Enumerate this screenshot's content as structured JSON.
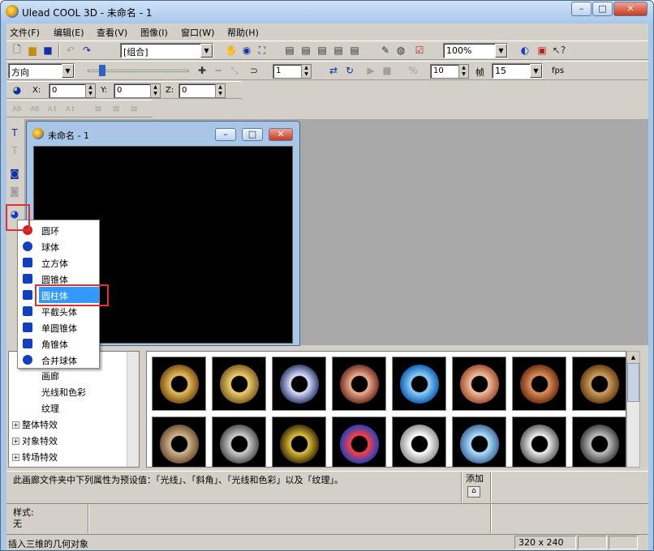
{
  "window": {
    "title": "Ulead COOL 3D - 未命名 - 1",
    "buttons": [
      "–",
      "□",
      "✕"
    ]
  },
  "menubar": [
    "文件(F)",
    "编辑(E)",
    "查看(V)",
    "图像(I)",
    "窗口(W)",
    "帮助(H)"
  ],
  "toolbar1": {
    "object_combo": "[组合]",
    "zoom_combo": "100%"
  },
  "toolbar2": {
    "mode_combo": "方向",
    "frame_value": "1",
    "fps_value": "10",
    "frames_label": "帧",
    "frames_value": "15",
    "fps_label": "fps"
  },
  "toolbar3": {
    "x_label": "X:",
    "x_value": "0",
    "y_label": "Y:",
    "y_value": "0",
    "z_label": "Z:",
    "z_value": "0"
  },
  "doc": {
    "title": "未命名 - 1",
    "buttons": [
      "–",
      "□",
      "✕"
    ]
  },
  "shape_menu": [
    {
      "label": "圆环",
      "icon": "torus-icon",
      "color": "#d02020"
    },
    {
      "label": "球体",
      "icon": "sphere-icon",
      "color": "#1040c0"
    },
    {
      "label": "立方体",
      "icon": "cube-icon",
      "color": "#1040c0"
    },
    {
      "label": "圆锥体",
      "icon": "cone-icon",
      "color": "#1040c0"
    },
    {
      "label": "圆柱体",
      "icon": "cylinder-icon",
      "color": "#1040c0",
      "selected": true
    },
    {
      "label": "平截头体",
      "icon": "frustum-icon",
      "color": "#1040c0"
    },
    {
      "label": "单圆锥体",
      "icon": "single-cone-icon",
      "color": "#1040c0"
    },
    {
      "label": "角锥体",
      "icon": "pyramid-icon",
      "color": "#1040c0"
    },
    {
      "label": "合并球体",
      "icon": "merged-sphere-icon",
      "color": "#1040c0"
    }
  ],
  "tree": [
    "画廊",
    "光线和色彩",
    "纹理",
    "整体特效",
    "对象特效",
    "转场特效"
  ],
  "gallery": {
    "thumbnails": [
      {
        "name": "gold-torus",
        "c1": "#e8c060",
        "c2": "#7a5010"
      },
      {
        "name": "gold-ring-torus",
        "c1": "#f0d070",
        "c2": "#806020"
      },
      {
        "name": "chrome-torus",
        "c1": "#e0e0ff",
        "c2": "#304070"
      },
      {
        "name": "copper-torus",
        "c1": "#f0b090",
        "c2": "#703020"
      },
      {
        "name": "blue-torus",
        "c1": "#90d0ff",
        "c2": "#1060b0"
      },
      {
        "name": "peach-torus",
        "c1": "#f5c0a0",
        "c2": "#a05030"
      },
      {
        "name": "wood-torus",
        "c1": "#e09060",
        "c2": "#703010"
      },
      {
        "name": "bronze-torus",
        "c1": "#d0a060",
        "c2": "#6a4010"
      },
      {
        "name": "stone-torus",
        "c1": "#d0b890",
        "c2": "#705030"
      },
      {
        "name": "mesh-torus",
        "c1": "#d0d0d0",
        "c2": "#505050"
      },
      {
        "name": "spotted-torus",
        "c1": "#e0c040",
        "c2": "#403000"
      },
      {
        "name": "glass-torus",
        "c1": "#ff4040",
        "c2": "#2040c0"
      },
      {
        "name": "white-torus",
        "c1": "#ffffff",
        "c2": "#909090"
      },
      {
        "name": "sky-torus",
        "c1": "#b0e0ff",
        "c2": "#4070a0"
      },
      {
        "name": "silver-torus",
        "c1": "#f0f0f0",
        "c2": "#606060"
      },
      {
        "name": "grey-torus",
        "c1": "#c0c0c0",
        "c2": "#404040"
      }
    ]
  },
  "description": "此画廊文件夹中下列属性为预设值：「光线」、「斜角」、「光线和色彩」以及「纹理」。",
  "add_label": "添加",
  "style_label": "样式:",
  "style_value": "无",
  "status_text": "插入三维的几何对象",
  "status_size": "320 x 240"
}
